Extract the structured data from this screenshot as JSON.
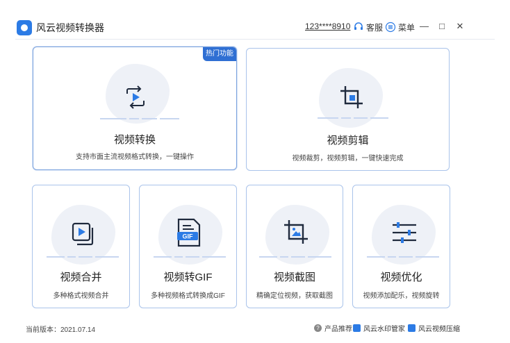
{
  "app": {
    "title": "风云视频转换器",
    "account": "123****8910",
    "service_label": "客服",
    "menu_label": "菜单",
    "minimize": "—",
    "maximize": "□",
    "close": "✕"
  },
  "cards": {
    "convert": {
      "title": "视频转换",
      "desc": "支持市面主流视频格式转换，一键操作",
      "badge": "热门功能",
      "icon": "video-convert-icon"
    },
    "edit": {
      "title": "视频剪辑",
      "desc": "视频裁剪，视频剪辑，一键快速完成",
      "icon": "crop-icon"
    },
    "merge": {
      "title": "视频合并",
      "desc": "多种格式视频合并",
      "icon": "video-merge-icon"
    },
    "gif": {
      "title": "视频转GIF",
      "desc": "多种视频格式转换成GIF",
      "icon": "gif-file-icon",
      "icon_text": "GIF"
    },
    "screenshot": {
      "title": "视频截图",
      "desc": "精确定位视频，获取截图",
      "icon": "crop-image-icon"
    },
    "optimize": {
      "title": "视频优化",
      "desc": "视频添加配乐，视频旋转",
      "icon": "sliders-icon"
    }
  },
  "footer": {
    "version": "当前版本：2021.07.14",
    "promo_label": "产品推荐：",
    "promo_app1": "风云水印管家",
    "promo_app2": "风云视频压缩"
  },
  "colors": {
    "accent": "#2f6fd3",
    "card_border": "#a9c3ea",
    "icon": "#1f2a3d"
  }
}
